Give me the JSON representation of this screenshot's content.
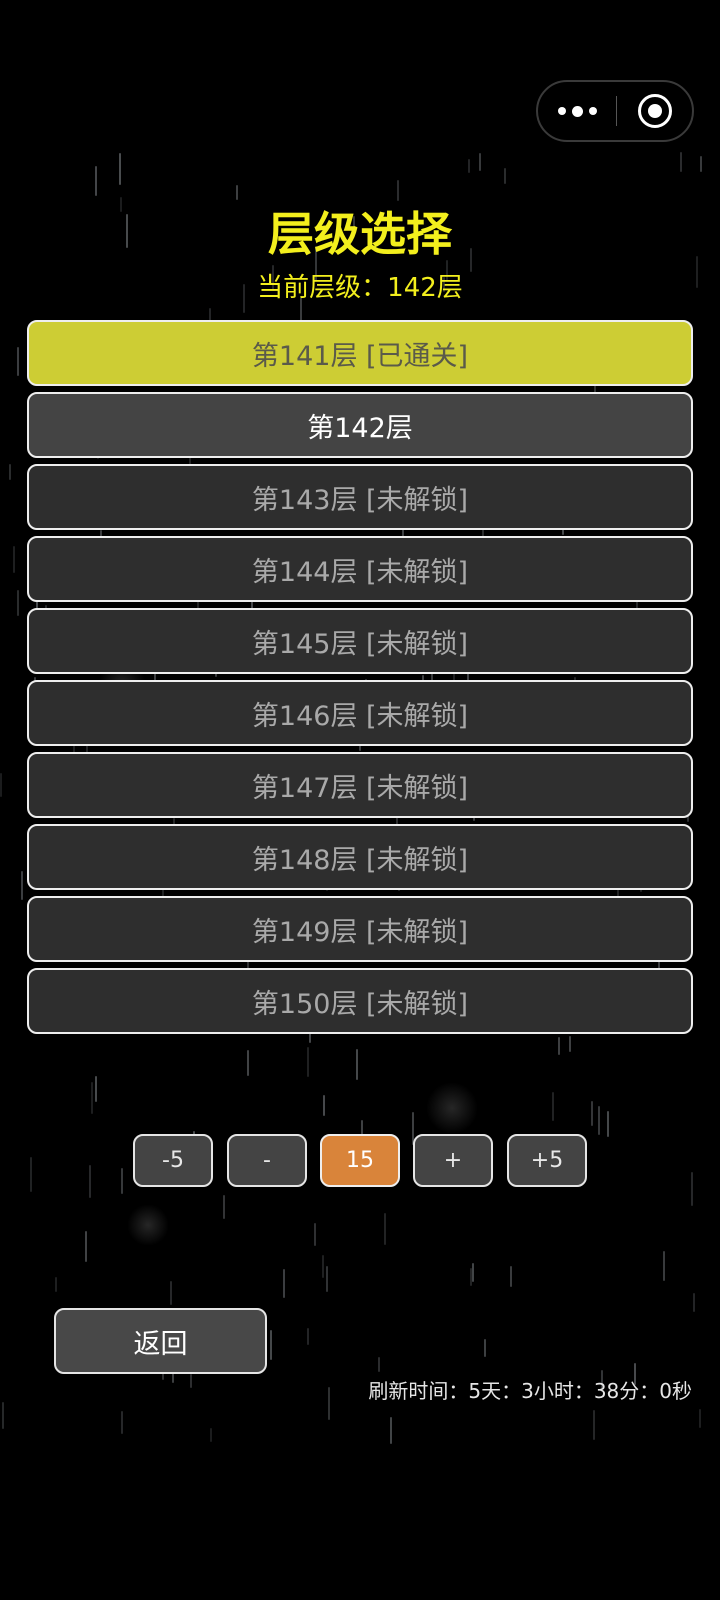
{
  "capsule": {
    "more_icon": "more-dots-icon",
    "close_icon": "target-circle-icon"
  },
  "header": {
    "title": "层级选择",
    "current_level": "当前层级：142层"
  },
  "levels": [
    {
      "label": "第141层 [已通关]",
      "state": "cleared"
    },
    {
      "label": "第142层",
      "state": "current"
    },
    {
      "label": "第143层 [未解锁]",
      "state": "locked"
    },
    {
      "label": "第144层 [未解锁]",
      "state": "locked"
    },
    {
      "label": "第145层 [未解锁]",
      "state": "locked"
    },
    {
      "label": "第146层 [未解锁]",
      "state": "locked"
    },
    {
      "label": "第147层 [未解锁]",
      "state": "locked"
    },
    {
      "label": "第148层 [未解锁]",
      "state": "locked"
    },
    {
      "label": "第149层 [未解锁]",
      "state": "locked"
    },
    {
      "label": "第150层 [未解锁]",
      "state": "locked"
    }
  ],
  "pager": {
    "minus5": "-5",
    "minus1": "-",
    "page": "15",
    "plus1": "+",
    "plus5": "+5"
  },
  "back_label": "返回",
  "refresh_text": "刷新时间：5天：3小时：38分：0秒",
  "colors": {
    "title": "#f3ef1d",
    "cleared_bg": "#cdcd34",
    "active_page_bg": "#d9843a",
    "item_bg": "#2e2e2e"
  }
}
